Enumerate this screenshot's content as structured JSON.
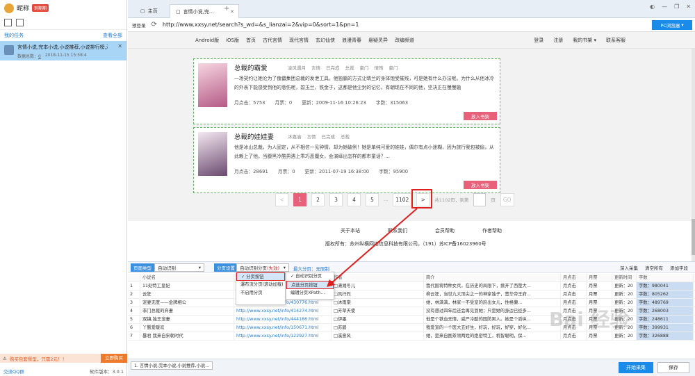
{
  "sidebar": {
    "username": "昵称",
    "trial_badge": "到期期",
    "task_header": "我的任务",
    "task_header_right": "查看全部",
    "task": {
      "name": "言情小说,完本小说,小说推荐,小说排行榜,淫",
      "data_label": "数据总数：",
      "data_count": "0",
      "date": "2018-11-15 15:58:4"
    },
    "promo_text": "购买包套餐型，只需2元！！",
    "promo_button": "立即购买",
    "qq_label": "交流QQ群",
    "version": "软件版本：3.0.1"
  },
  "browser": {
    "tabs": [
      {
        "label": "主页"
      },
      {
        "label": "言情小说,完..."
      }
    ],
    "tab_plus": "+",
    "win_controls": [
      "◐",
      "—",
      "❐",
      "✕"
    ],
    "login_label": "预登录",
    "url": "http://www.xxsy.net/search?s_wd=&s_lianzai=2&vip=0&sort=1&pn=1",
    "pc_browser": "PC浏览器"
  },
  "site_nav": {
    "items": [
      "Android版",
      "iOS版",
      "首页",
      "古代言情",
      "现代言情",
      "玄幻仙侠",
      "浪漫青春",
      "悬疑灵异",
      "改编频道"
    ],
    "right": [
      "登录",
      "注册",
      "我的书架 ▾",
      "联系客服"
    ]
  },
  "books": [
    {
      "title": "总裁的霸爱",
      "tags": [
        "凌风遇月",
        "言情",
        "已完成",
        "总裁",
        "豪门",
        "情殇",
        "豪门"
      ],
      "desc": "一场契约让她沦为了傀儡集团总裁的发泄工具。他独霸的方式让晴兰的身体饱受摧残，可是她有什么办法呢。为什么从他冰冷的外表下能感受到他的悲伤呢，碧玉兰，铁金子，这都是他尘封的记忆，有朝现在不同的他，坚决正在慢慢融",
      "clicks": "月点击：5753",
      "votes": "月票：0",
      "updated": "更新：2009-11-16 10:26:23",
      "words": "字数：315063",
      "shelf": "放入书架"
    },
    {
      "title": "总裁的娃娃妻",
      "tags": [
        "沐嘉庙",
        "言情",
        "已完成",
        "总裁"
      ],
      "desc": "他是冰山总裁，为人固定，从不相信一见钟情，却为她破例！她是单纯可爱的娃娃，偶尔有点小迷糊，因为旅行我包被偷，从此赖上了他。当腹黑冷酷男遇上乖巧恶魔女，会演绎出怎样的都市童话？...",
      "clicks": "月点击：28691",
      "votes": "月票：0",
      "updated": "更新：2011-07-19 16:38:00",
      "words": "字数：95900",
      "shelf": "放入书架"
    }
  ],
  "pager": {
    "prev": "<",
    "pages": [
      "1",
      "2",
      "3",
      "4",
      "5",
      "...",
      "1102"
    ],
    "next": ">",
    "info": "共1102页，到第",
    "page_unit": "页",
    "go": "GO"
  },
  "footer": {
    "links": [
      "关于本站",
      "联系我们",
      "会员帮助",
      "作者帮助"
    ],
    "copyright": "版权所有：苏州纵横网络信息科技有限公司。（191）苏ICP备16023960号"
  },
  "panel": {
    "tag1": "页面类型",
    "sel1": "自动识别",
    "tag2": "分页设置",
    "sel2": "自动识别分页",
    "sel2_extra": "(失效)",
    "link": "最大分页：无限制",
    "right_actions": [
      "深入采集",
      "清空所有",
      "添加字段"
    ],
    "dropdown1": [
      "✓ 分页按钮",
      "瀑布流分页(滚动加载)",
      "不启用分页"
    ],
    "dropdown2": [
      "✓ 自动识别分页",
      "点选分页按钮",
      "编辑分页XPath..."
    ],
    "columns": [
      "",
      "小说名",
      "",
      "作者",
      "简介",
      "月点击",
      "月票",
      "更新时间",
      "字数"
    ],
    "rows": [
      [
        "1",
        "11处特工皇妃",
        "",
        "□潇湘冬儿",
        "我代国将特种女兵，在历史的局限下，掀开了西楚大...",
        "月点击",
        "月票",
        "更新：20",
        "字数：980041"
      ],
      [
        "2",
        "云狂",
        "",
        "□风行烈",
        "柳云狂，当世九大顶尖之一的神家独子，楚华帝王府...",
        "月点击",
        "月票",
        "更新：20",
        "字数：805262"
      ],
      [
        "3",
        "宠妻无度——金牌相公",
        "http://www.xxsy.net/info/430776.html",
        "□沐雨棠",
        "她，林满满，林家一不受宠的庶出女儿，性格懒...",
        "月点击",
        "月票",
        "更新：20",
        "字数：489769"
      ],
      [
        "4",
        "非门总裁的弃妻",
        "http://www.xxsy.net/info/414274.html",
        "□芳草天使",
        "没有想过四年后还会再见到她；只是她的身边已经多...",
        "月点击",
        "月票",
        "更新：20",
        "字数：268003"
      ],
      [
        "5",
        "双镜,独王宠妻",
        "http://www.xxsy.net/info/444186.html",
        "□伊墨",
        "他是个铁血无情，威严冷酷的国防男人。她是个骄纵...",
        "月点击",
        "月票",
        "更新：20",
        "字数：248611"
      ],
      [
        "6",
        "丫鬟爱暖欢",
        "http://www.xxsy.net/info/150671.html",
        "□苏碧",
        "我爱宣的一个医大五好生，好玩，好玩，好穿，好化...",
        "月点击",
        "月票",
        "更新：20",
        "字数：399931"
      ],
      [
        "7",
        "暴君 我来自宋朝时代",
        "http://www.xxsy.net/info/122927.html",
        "□溪意风",
        "她，是来自图茶领两姓的绝密特工，机智聪明，保...",
        "月点击",
        "月票",
        "更新：20",
        "字数：326888"
      ]
    ]
  },
  "bottom": {
    "tab": "1. 言情小说,完本小说,小说推荐,小说...",
    "start": "开始采集",
    "save": "保存"
  },
  "watermark": "Bai 经验"
}
